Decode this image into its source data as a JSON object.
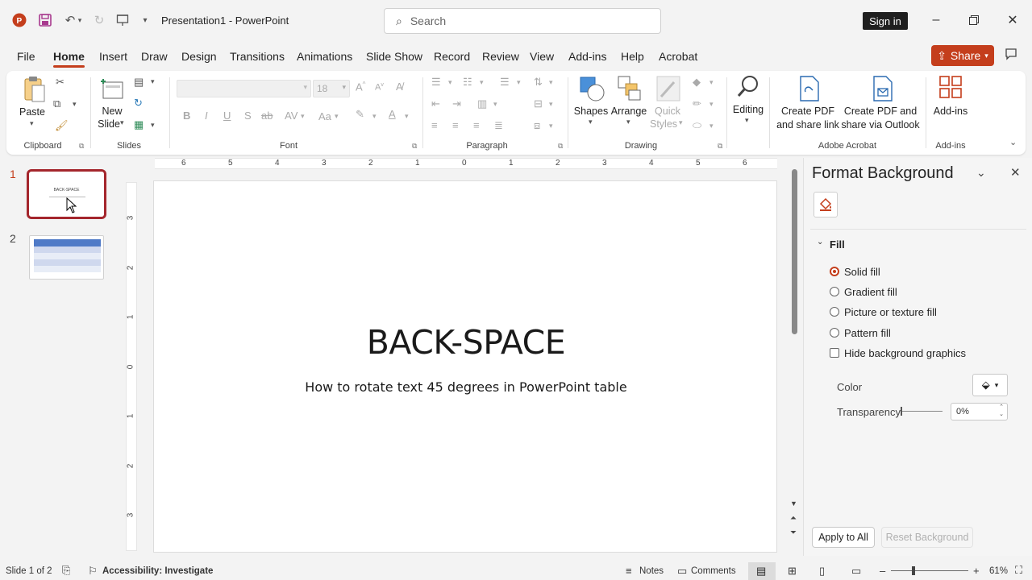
{
  "titlebar": {
    "title": "Presentation1  -  PowerPoint",
    "search_placeholder": "Search",
    "signin_label": "Sign in"
  },
  "tabs": [
    "File",
    "Home",
    "Insert",
    "Draw",
    "Design",
    "Transitions",
    "Animations",
    "Slide Show",
    "Record",
    "Review",
    "View",
    "Add-ins",
    "Help",
    "Acrobat"
  ],
  "active_tab": "Home",
  "share_label": "Share",
  "ribbon": {
    "clipboard": {
      "paste": "Paste",
      "group": "Clipboard"
    },
    "slides": {
      "new_slide_1": "New",
      "new_slide_2": "Slide",
      "group": "Slides"
    },
    "font": {
      "size": "18",
      "group": "Font"
    },
    "paragraph": {
      "group": "Paragraph"
    },
    "drawing": {
      "shapes": "Shapes",
      "arrange": "Arrange",
      "quick_styles_1": "Quick",
      "quick_styles_2": "Styles",
      "group": "Drawing"
    },
    "editing": {
      "label": "Editing"
    },
    "acrobat": {
      "pdf_link_1": "Create PDF",
      "pdf_link_2": "and share link",
      "pdf_outlook_1": "Create PDF and",
      "pdf_outlook_2": "share via Outlook",
      "group": "Adobe Acrobat"
    },
    "addins": {
      "label": "Add-ins",
      "group": "Add-ins"
    }
  },
  "thumbnails": [
    {
      "number": "1",
      "text": "BACK-SPACE"
    },
    {
      "number": "2"
    }
  ],
  "ruler": {
    "h_ticks": [
      "6",
      "5",
      "4",
      "3",
      "2",
      "1",
      "0",
      "1",
      "2",
      "3",
      "4",
      "5",
      "6"
    ],
    "v_ticks": [
      "3",
      "2",
      "1",
      "0",
      "1",
      "2",
      "3"
    ]
  },
  "slide": {
    "title": "BACK-SPACE",
    "subtitle": "How to rotate text 45 degrees in PowerPoint table"
  },
  "format_panel": {
    "title": "Format Background",
    "section": "Fill",
    "options": [
      {
        "label": "Solid fill",
        "checked": true
      },
      {
        "label": "Gradient fill",
        "checked": false
      },
      {
        "label": "Picture or texture fill",
        "checked": false
      },
      {
        "label": "Pattern fill",
        "checked": false
      }
    ],
    "hide_graphics": "Hide background graphics",
    "color_label": "Color",
    "transparency_label": "Transparency",
    "transparency_value": "0%",
    "apply_all": "Apply to All",
    "reset": "Reset Background"
  },
  "statusbar": {
    "slide_info": "Slide 1 of 2",
    "accessibility": "Accessibility: Investigate",
    "notes": "Notes",
    "comments": "Comments",
    "zoom": "61%"
  },
  "colors": {
    "accent": "#c43e1c",
    "selected_thumb": "#a4262c"
  }
}
